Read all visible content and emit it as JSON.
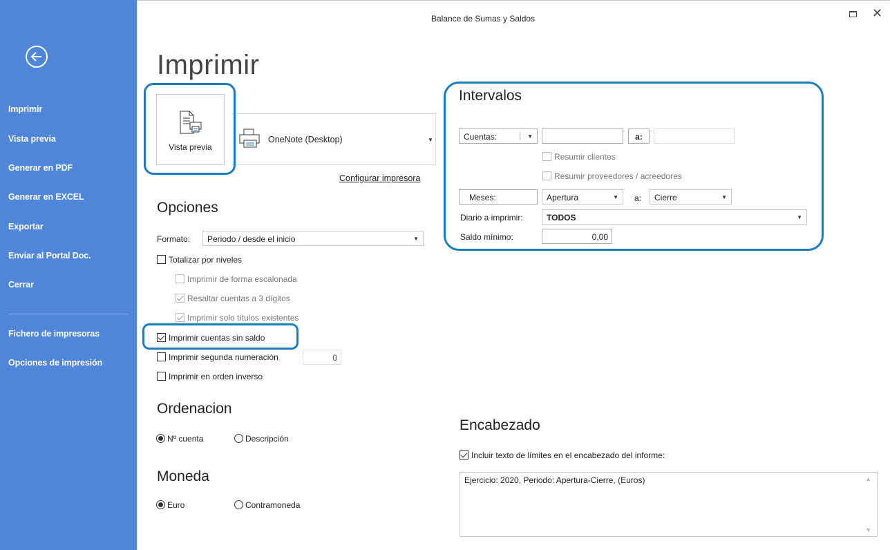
{
  "window": {
    "title": "Balance de Sumas y Saldos"
  },
  "sidebar": {
    "items": [
      {
        "label": "Imprimir"
      },
      {
        "label": "Vista previa"
      },
      {
        "label": "Generar en PDF"
      },
      {
        "label": "Generar en EXCEL"
      },
      {
        "label": "Exportar"
      },
      {
        "label": "Enviar al Portal Doc."
      },
      {
        "label": "Cerrar"
      },
      {
        "label": "Fichero de impresoras"
      },
      {
        "label": "Opciones de impresión"
      }
    ]
  },
  "page": {
    "title": "Imprimir"
  },
  "preview": {
    "label": "Vista previa"
  },
  "printer": {
    "name": "OneNote (Desktop)",
    "config_link": "Configurar impresora"
  },
  "opciones": {
    "title": "Opciones",
    "formato_label": "Formato:",
    "formato_value": "Periodo / desde el inicio",
    "checkboxes": [
      {
        "label": "Totalizar por niveles"
      },
      {
        "label": "Imprimir de forma escalonada"
      },
      {
        "label": "Resaltar cuentas a 3 dígitos"
      },
      {
        "label": "Imprimir solo títulos existentes"
      },
      {
        "label": "Imprimir cuentas sin saldo"
      },
      {
        "label": "Imprimir segunda numeración"
      },
      {
        "label": "Imprimir en orden inverso"
      }
    ],
    "segunda_numeracion_value": "0"
  },
  "ordenacion": {
    "title": "Ordenacion",
    "options": [
      {
        "label": "Nº cuenta"
      },
      {
        "label": "Descripción"
      }
    ]
  },
  "moneda": {
    "title": "Moneda",
    "options": [
      {
        "label": "Euro"
      },
      {
        "label": "Contramoneda"
      }
    ]
  },
  "intervalos": {
    "title": "Intervalos",
    "cuentas_label": "Cuentas:",
    "cuentas_from": "",
    "a_label": "a:",
    "cuentas_to": "",
    "resumir_clientes": "Resumir clientes",
    "resumir_proveedores": "Resumir proveedores / acreedores",
    "meses_label": "Meses:",
    "meses_from": "Apertura",
    "meses_to": "Cierre",
    "diario_label": "Diario a imprimir:",
    "diario_value": "TODOS",
    "saldo_label": "Saldo mínimo:",
    "saldo_value": "0,00"
  },
  "encabezado": {
    "title": "Encabezado",
    "checkbox_label": "Incluir texto de límites en el encabezado del informe:",
    "text": "Ejercicio: 2020, Periodo: Apertura-Cierre, (Euros)"
  },
  "colors": {
    "sidebar": "#4f86d9",
    "highlight": "#1a7dc0"
  }
}
